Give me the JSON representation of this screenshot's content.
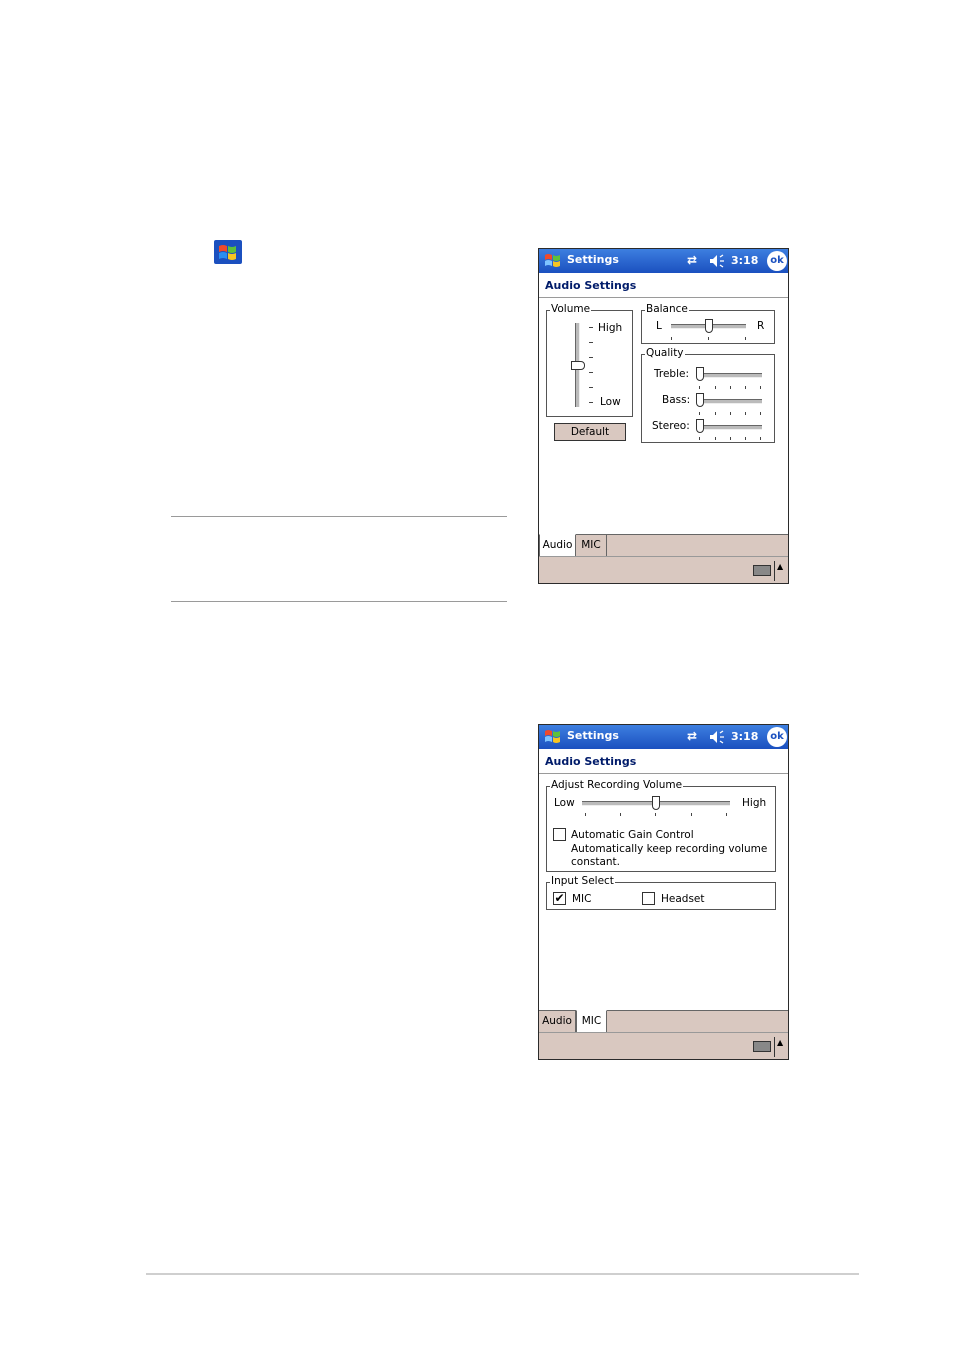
{
  "device1": {
    "title": "Settings",
    "clock": "3:18",
    "ok_label": "ok",
    "header": "Audio Settings",
    "volume": {
      "group_label": "Volume",
      "high_label": "High",
      "low_label": "Low",
      "level": 0.5
    },
    "default_label": "Default",
    "balance": {
      "group_label": "Balance",
      "left_label": "L",
      "right_label": "R",
      "level": 0.5
    },
    "quality": {
      "group_label": "Quality",
      "treble_label": "Treble:",
      "bass_label": "Bass:",
      "stereo_label": "Stereo:",
      "treble_level": 0,
      "bass_level": 0,
      "stereo_level": 0
    },
    "tabs": {
      "audio": "Audio",
      "mic": "MIC",
      "active": "Audio"
    }
  },
  "device2": {
    "title": "Settings",
    "clock": "3:18",
    "ok_label": "ok",
    "header": "Audio Settings",
    "recording": {
      "group_label": "Adjust Recording Volume",
      "low_label": "Low",
      "high_label": "High",
      "level": 0.5,
      "agc_label": "Automatic Gain Control",
      "agc_desc_line1": "Automatically keep recording volume",
      "agc_desc_line2": "constant.",
      "agc_checked": false
    },
    "input_select": {
      "group_label": "Input Select",
      "mic_label": "MIC",
      "mic_checked": true,
      "headset_label": "Headset",
      "headset_checked": false
    },
    "tabs": {
      "audio": "Audio",
      "mic": "MIC",
      "active": "MIC"
    }
  },
  "colors": {
    "titlebar": "#1b50bf",
    "header_text": "#001b6a",
    "chrome": "#d9c8c0"
  },
  "icons": [
    "windows-flag-icon",
    "sync-icon",
    "speaker-icon",
    "ok-icon",
    "keyboard-icon",
    "up-arrow-icon",
    "checkmark-icon"
  ]
}
